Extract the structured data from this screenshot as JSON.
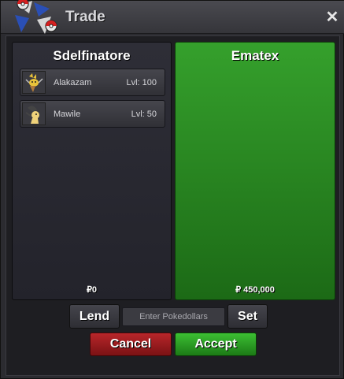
{
  "window": {
    "title": "Trade",
    "close_symbol": "✕"
  },
  "left_panel": {
    "player_name": "Sdelfinatore",
    "money": "₽0",
    "pokemon": [
      {
        "name": "Alakazam",
        "level": "Lvl: 100",
        "icon": "alakazam-icon"
      },
      {
        "name": "Mawile",
        "level": "Lvl: 50",
        "icon": "mawile-icon"
      }
    ]
  },
  "right_panel": {
    "player_name": "Ematex",
    "money": "₽ 450,000"
  },
  "controls": {
    "lend_label": "Lend",
    "money_placeholder": "Enter Pokedollars",
    "set_label": "Set",
    "cancel_label": "Cancel",
    "accept_label": "Accept"
  },
  "colors": {
    "accept_green": "#2a9a22",
    "cancel_red": "#a01e22",
    "partner_panel_green": "#2a8a22"
  }
}
